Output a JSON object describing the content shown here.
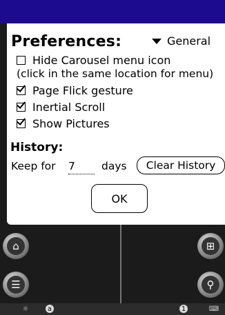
{
  "dialog": {
    "title": "Preferences:",
    "dropdown_value": "General",
    "options": [
      {
        "label": "Hide Carousel menu icon",
        "checked": false
      },
      {
        "label": "Page Flick gesture",
        "checked": true
      },
      {
        "label": "Inertial Scroll",
        "checked": true
      },
      {
        "label": "Show Pictures",
        "checked": true
      }
    ],
    "note": "(click in the same location for menu)",
    "history_label": "History:",
    "keep_for_label": "Keep for",
    "days_value": "7",
    "days_label": "days",
    "clear_history_label": "Clear History",
    "ok_label": "OK"
  },
  "colors": {
    "topbar": "#1c0a8f",
    "background": "#1b1b1b",
    "dialog": "#ffffff"
  },
  "footer": {
    "left_badge": "a",
    "right_badge": "1"
  }
}
